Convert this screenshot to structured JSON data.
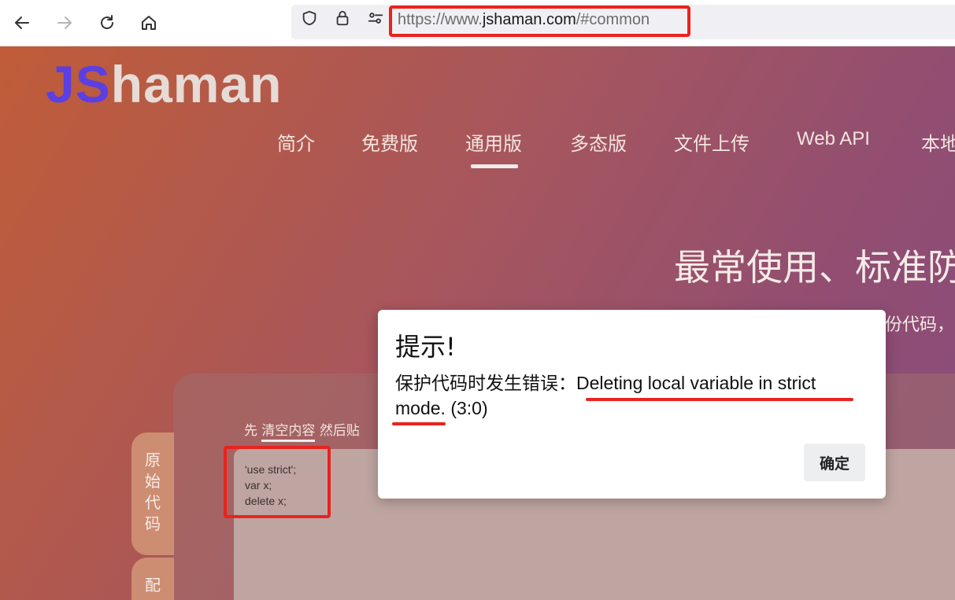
{
  "browser": {
    "url_prefix": "https://www.",
    "url_domain": "jshaman.com",
    "url_suffix": "/#common",
    "icons": [
      "back-arrow-icon",
      "forward-arrow-icon",
      "reload-icon",
      "home-icon",
      "shield-icon",
      "lock-icon",
      "permissions-icon"
    ]
  },
  "site": {
    "logo_j": "J",
    "logo_s": "S",
    "logo_rest": "haman",
    "menu": [
      "简介",
      "免费版",
      "通用版",
      "多态版",
      "文件上传",
      "Web API",
      "本地"
    ],
    "active_menu": "通用版",
    "hero_title": "最常使用、标准防",
    "hero_sub": "份代码，"
  },
  "editor": {
    "hint_before": "先",
    "hint_clear": "清空内容",
    "hint_after": "然后贴",
    "side_tab_label": "原始代码",
    "side_tab2_label": "配",
    "code_lines": [
      "'use strict';",
      "var x;",
      "delete x;"
    ]
  },
  "dialog": {
    "title": "提示!",
    "message_zh": "保护代码时发生错误：",
    "message_en": "Deleting local variable in strict mode. (3:0)",
    "ok_label": "确定"
  },
  "colors": {
    "highlight_red": "#e8231f",
    "logo_purple": "#5b3fe0"
  }
}
